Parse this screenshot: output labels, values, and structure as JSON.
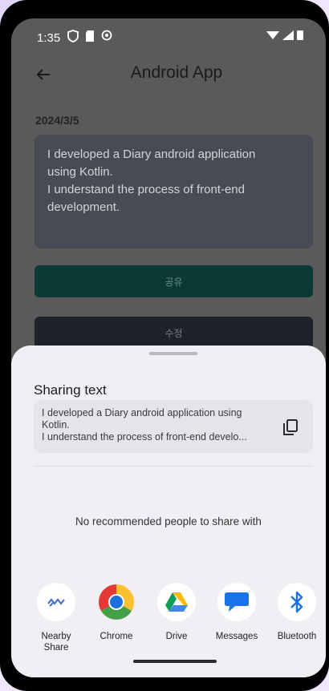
{
  "status_bar": {
    "time": "1:35"
  },
  "app_bar": {
    "title": "Android App"
  },
  "diary": {
    "date": "2024/3/5",
    "text_line1": "I developed a Diary android application",
    "text_line2": "using Kotlin.",
    "text_line3": "I understand the process of front-end",
    "text_line4": "development."
  },
  "buttons": {
    "share_label": "공유",
    "edit_label": "수정"
  },
  "share_sheet": {
    "title": "Sharing text",
    "preview_line1": "I developed a Diary android application using",
    "preview_line2": "Kotlin.",
    "preview_line3": "I understand the process of front-end develo...",
    "no_recommendations": "No recommended people to share with",
    "apps": [
      {
        "label": "Nearby\nShare",
        "icon": "nearby-share-icon"
      },
      {
        "label": "Chrome",
        "icon": "chrome-icon"
      },
      {
        "label": "Drive",
        "icon": "drive-icon"
      },
      {
        "label": "Messages",
        "icon": "messages-icon"
      },
      {
        "label": "Bluetooth",
        "icon": "bluetooth-icon"
      }
    ]
  },
  "colors": {
    "share_button": "#0b3a36",
    "edit_button": "#1e222b",
    "sheet_bg": "#f1eff4"
  }
}
